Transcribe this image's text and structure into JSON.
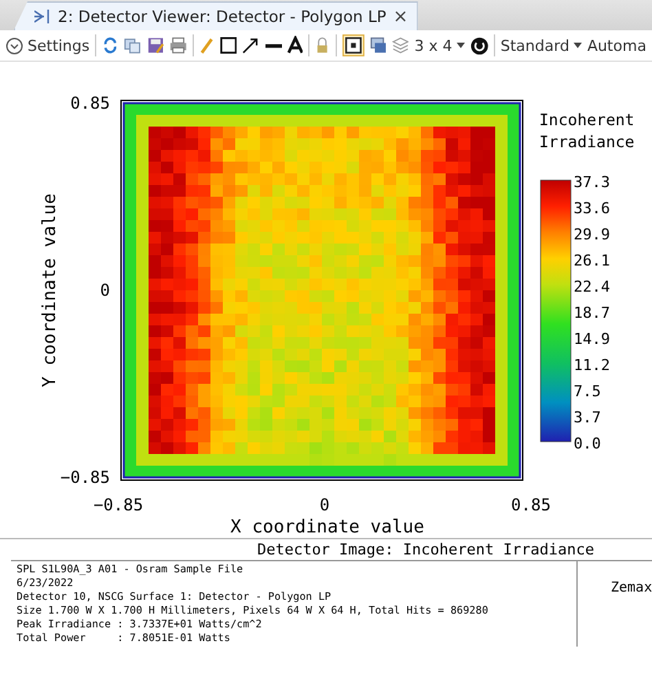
{
  "tab": {
    "title": "2: Detector Viewer: Detector - Polygon LP",
    "close": "×",
    "selected": true
  },
  "toolbar": {
    "settings": "Settings",
    "layout": "3 x 4",
    "mode": "Standard",
    "auto": "Automa"
  },
  "plot": {
    "xlabel": "X coordinate value",
    "ylabel": "Y coordinate value",
    "xticks": [
      "−0.85",
      "0",
      "0.85"
    ],
    "yticks": [
      "0.85",
      "0",
      "−0.85"
    ],
    "legend_title": "Incoherent Irradiance",
    "legend_ticks": [
      "37.3",
      "33.6",
      "29.9",
      "26.1",
      "22.4",
      "18.7",
      "14.9",
      "11.2",
      "7.5",
      "3.7",
      "0.0"
    ]
  },
  "info": {
    "title": "Detector Image: Incoherent Irradiance",
    "lines": [
      "SPL S1L90A_3 A01 - Osram Sample File",
      "6/23/2022",
      "Detector 10, NSCG Surface 1: Detector - Polygon LP",
      "Size 1.700 W X 1.700 H Millimeters, Pixels 64 W X 64 H, Total Hits = 869280",
      "Peak Irradiance : 3.7337E+01 Watts/cm^2",
      "Total Power     : 7.8051E-01 Watts"
    ],
    "side": "Zemax"
  }
}
